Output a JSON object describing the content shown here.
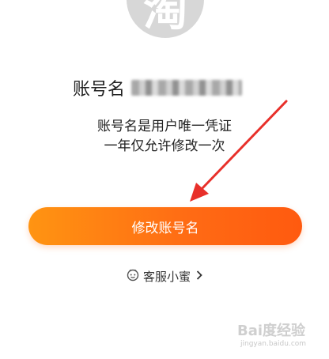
{
  "profile": {
    "avatar_glyph": "淘",
    "account_label": "账号名",
    "account_value": ""
  },
  "description": {
    "line1": "账号名是用户唯一凭证",
    "line2": "一年仅允许修改一次"
  },
  "actions": {
    "modify_label": "修改账号名"
  },
  "service": {
    "label": "客服小蜜",
    "icon": "robot-face-icon",
    "chevron": "chevron-right-icon"
  },
  "annotation": {
    "arrow_color": "#e8302a"
  },
  "watermark": {
    "brand": "Bai度经验",
    "url": "jingyan.baidu.com"
  },
  "colors": {
    "button_start": "#ff9412",
    "button_end": "#ff5a0f",
    "text": "#222222"
  }
}
